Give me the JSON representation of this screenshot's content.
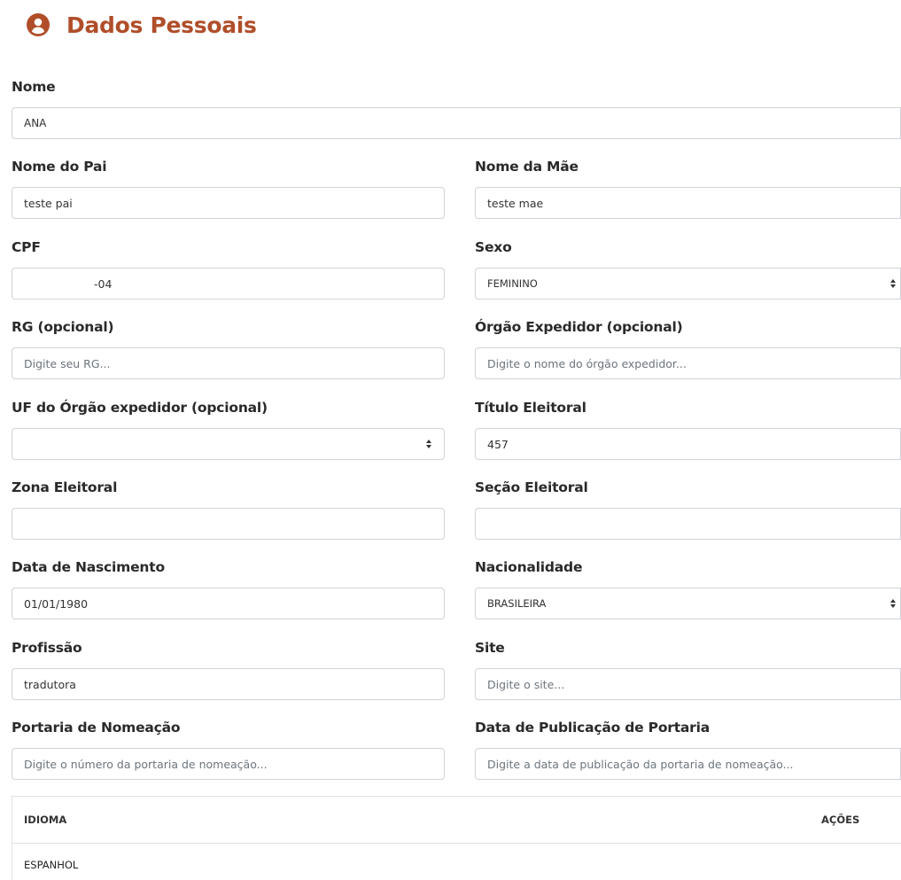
{
  "header": {
    "title": "Dados Pessoais",
    "icon": "user-circle-icon",
    "color": "#b04e2a"
  },
  "form": {
    "nome": {
      "label": "Nome",
      "value": "ANA"
    },
    "nome_pai": {
      "label": "Nome do Pai",
      "value": "teste pai"
    },
    "nome_mae": {
      "label": "Nome da Mãe",
      "value": "teste mae"
    },
    "cpf": {
      "label": "CPF",
      "value": "-04"
    },
    "sexo": {
      "label": "Sexo",
      "value": "FEMININO"
    },
    "rg": {
      "label": "RG (opcional)",
      "placeholder": "Digite seu RG..."
    },
    "orgao_expedidor": {
      "label": "Órgão Expedidor (opcional)",
      "placeholder": "Digite o nome do órgão expedidor..."
    },
    "uf_orgao": {
      "label": "UF do Órgão expedidor (opcional)",
      "value": ""
    },
    "titulo_eleitoral": {
      "label": "Título Eleitoral",
      "value": "457"
    },
    "zona_eleitoral": {
      "label": "Zona Eleitoral",
      "value": ""
    },
    "secao_eleitoral": {
      "label": "Seção Eleitoral",
      "value": ""
    },
    "data_nascimento": {
      "label": "Data de Nascimento",
      "value": "01/01/1980"
    },
    "nacionalidade": {
      "label": "Nacionalidade",
      "value": "BRASILEIRA"
    },
    "profissao": {
      "label": "Profissão",
      "value": "tradutora"
    },
    "site": {
      "label": "Site",
      "placeholder": "Digite o site..."
    },
    "portaria_nomeacao": {
      "label": "Portaria de Nomeação",
      "placeholder": "Digite o número da portaria de nomeação..."
    },
    "data_publicacao_portaria": {
      "label": "Data de Publicação de Portaria",
      "placeholder": "Digite a data de publicação da portaria de nomeação..."
    }
  },
  "idiomas_table": {
    "headers": {
      "idioma": "IDIOMA",
      "acoes": "AÇÕES"
    },
    "rows": [
      {
        "idioma": "ESPANHOL"
      }
    ]
  }
}
